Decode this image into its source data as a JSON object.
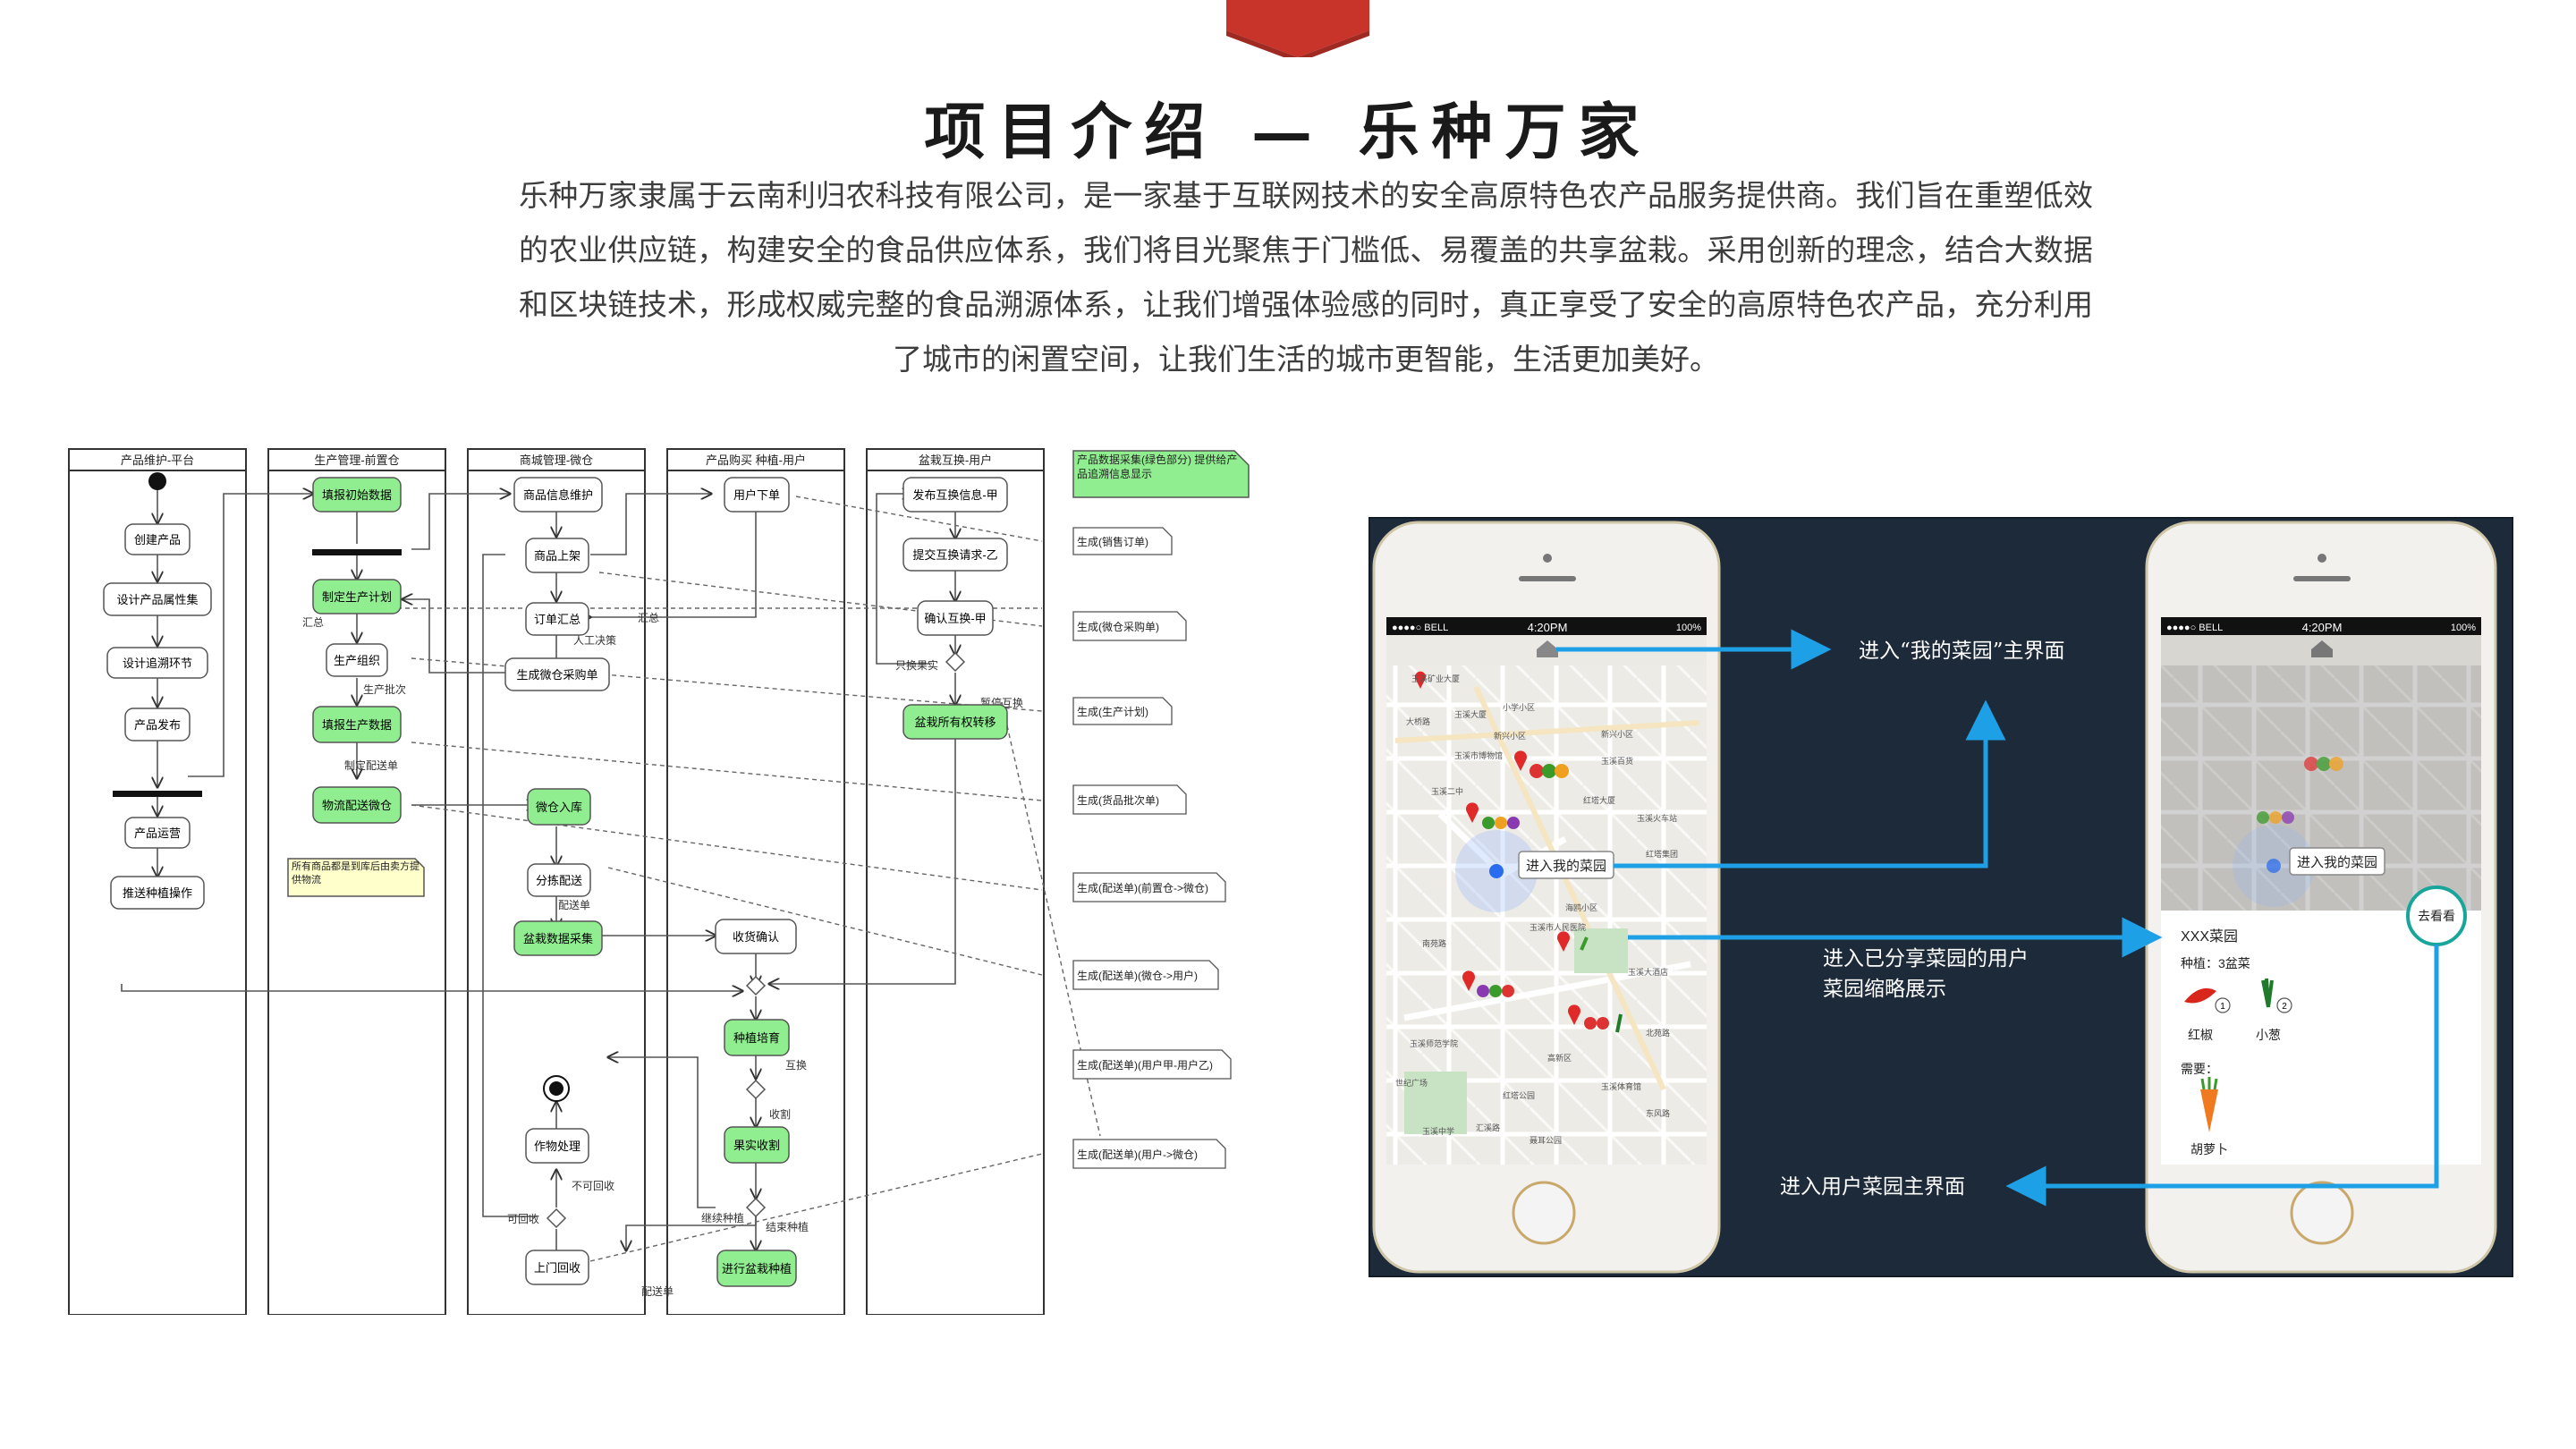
{
  "header": {
    "title": "项目介绍 — 乐种万家",
    "intro": "乐种万家隶属于云南利归农科技有限公司，是一家基于互联网技术的安全高原特色农产品服务提供商。我们旨在重塑低效的农业供应链，构建安全的食品供应体系，我们将目光聚焦于门槛低、易覆盖的共享盆栽。采用创新的理念，结合大数据和区块链技术，形成权威完整的食品溯源体系，让我们增强体验感的同时，真正享受了安全的高原特色农产品，充分利用了城市的闲置空间，让我们生活的城市更智能，生活更加美好。"
  },
  "colors": {
    "accent": "#c9342a",
    "green": "#90ee90",
    "note": "#ffffcc",
    "arrow": "#1ea0e6",
    "panel": "#1d2a3a"
  },
  "uml": {
    "lanes": [
      "产品维护-平台",
      "生产管理-前置仓",
      "商城管理-微仓",
      "产品购买 种植-用户",
      "盆栽互换-用户"
    ],
    "nodes": {
      "create": "创建产品",
      "attr": "设计产品属性集",
      "trace": "设计追溯环节",
      "publish": "产品发布",
      "operate": "产品运营",
      "push": "推送种植操作",
      "fill_init": "填报初始数据",
      "make_plan": "制定生产计划",
      "prod_org": "生产组织",
      "fill_prod": "填报生产数据",
      "deliver": "物流配送微仓",
      "info_maint": "商品信息维护",
      "shelf": "商品上架",
      "summary": "订单汇总",
      "gen_po": "生成微仓采购单",
      "in_stock": "微仓入库",
      "distribute": "分拣配送",
      "pot_collect": "盆栽数据采集",
      "order": "用户下单",
      "receive": "收货确认",
      "manage": "种植培育",
      "harvest": "果实收割",
      "deal": "作物处理",
      "visit": "上门回收",
      "enjoy": "进行盆栽种植",
      "exch_pub": "发布互换信息-甲",
      "exch_req": "提交互换请求-乙",
      "exch_ok": "确认互换-甲",
      "transfer": "盆栽所有权转移"
    },
    "labels": {
      "hz1": "汇总",
      "hz2": "汇总",
      "batch": "生产批次",
      "mk_del": "制定配送单",
      "manual": "人工决策",
      "del_note": "配送单",
      "only": "只换果实",
      "pause": "暂停互换",
      "exch": "互换",
      "harv": "收割",
      "no_rec": "不可回收",
      "rec": "可回收",
      "cont": "继续种植",
      "end": "结束种植",
      "del2": "配送单"
    },
    "notes": {
      "green_note": "产品数据采集(绿色部分) 提供给产品追溯信息显示",
      "yellow_note": "所有商品都是到库后由卖方提供物流"
    },
    "docs": [
      "生成(销售订单)",
      "生成(微仓采购单)",
      "生成(生产计划)",
      "生成(货品批次单)",
      "生成(配送单)(前置仓->微仓)",
      "生成(配送单)(微仓->用户)",
      "生成(配送单)(用户甲-用户乙)",
      "生成(配送单)(用户->微仓)"
    ]
  },
  "phones": {
    "status_carrier": "●●●●○ BELL",
    "status_time": "4:20PM",
    "status_battery": "100%",
    "map_labels": [
      "玉溪矿业大厦",
      "大桥路",
      "小学小区",
      "玉溪大厦",
      "新兴小区",
      "玉溪市博物馆",
      "玉溪百货",
      "新兴小区",
      "玉溪二中",
      "红塔大厦",
      "玉溪火车站",
      "海鸥小区",
      "玉溪市人民医院",
      "南苑路",
      "红塔集团",
      "玉溪大酒店",
      "北苑路",
      "玉溪师范学院",
      "世纪广场",
      "高新区",
      "玉溪体育馆",
      "红塔公园",
      "东风路",
      "玉溪中学",
      "聂耳公园",
      "汇溪路"
    ],
    "btn_enter_garden": "进入我的菜园",
    "ann1": "进入“我的菜园”主界面",
    "ann2_l1": "进入已分享菜园的用户",
    "ann2_l2": "菜园缩略展示",
    "ann3": "进入用户菜园主界面",
    "go_look": "去看看",
    "card_title": "XXX菜园",
    "card_plant": "种植：3盆菜",
    "veg1": "红椒",
    "veg2": "小葱",
    "card_need": "需要：",
    "veg3": "胡萝卜"
  }
}
